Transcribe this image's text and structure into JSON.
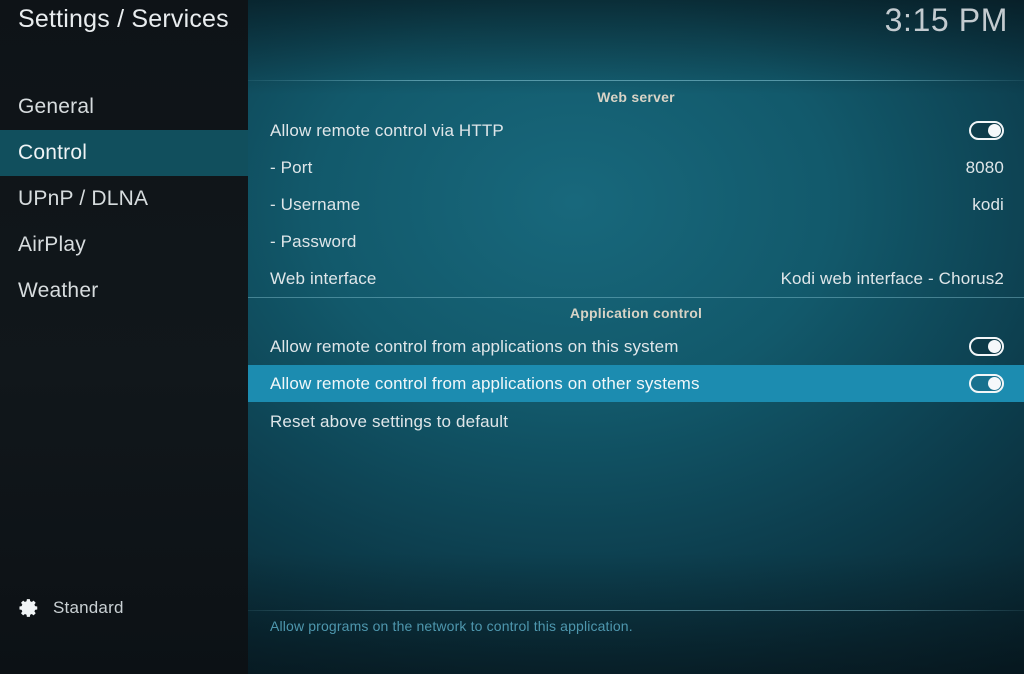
{
  "window": {
    "title": "Settings / Services",
    "clock": "3:15 PM"
  },
  "colors": {
    "sidebar_selected": "#114f5d",
    "row_highlight": "#1c8cb0",
    "help_text": "#4e97ae",
    "section_header_text": "#d8d3c6"
  },
  "sidebar": {
    "items": [
      {
        "label": "General",
        "selected": false
      },
      {
        "label": "Control",
        "selected": true
      },
      {
        "label": "UPnP / DLNA",
        "selected": false
      },
      {
        "label": "AirPlay",
        "selected": false
      },
      {
        "label": "Weather",
        "selected": false
      }
    ],
    "profile": {
      "icon": "gear-icon",
      "label": "Standard"
    }
  },
  "main": {
    "sections": [
      {
        "header": "Web server",
        "rows": [
          {
            "label": "Allow remote control via HTTP",
            "control": "toggle",
            "toggle_state": "on",
            "value": ""
          },
          {
            "label": "- Port",
            "control": "value",
            "value": "8080"
          },
          {
            "label": "- Username",
            "control": "value",
            "value": "kodi"
          },
          {
            "label": "- Password",
            "control": "value",
            "value": ""
          },
          {
            "label": "Web interface",
            "control": "value",
            "value": "Kodi web interface - Chorus2"
          }
        ]
      },
      {
        "header": "Application control",
        "rows": [
          {
            "label": "Allow remote control from applications on this system",
            "control": "toggle",
            "toggle_state": "on",
            "value": "",
            "highlighted": false
          },
          {
            "label": "Allow remote control from applications on other systems",
            "control": "toggle",
            "toggle_state": "on",
            "value": "",
            "highlighted": true
          }
        ]
      },
      {
        "header": "",
        "rows": [
          {
            "label": "Reset above settings to default",
            "control": "none",
            "value": ""
          }
        ]
      }
    ],
    "help_text": "Allow programs on the network to control this application."
  }
}
